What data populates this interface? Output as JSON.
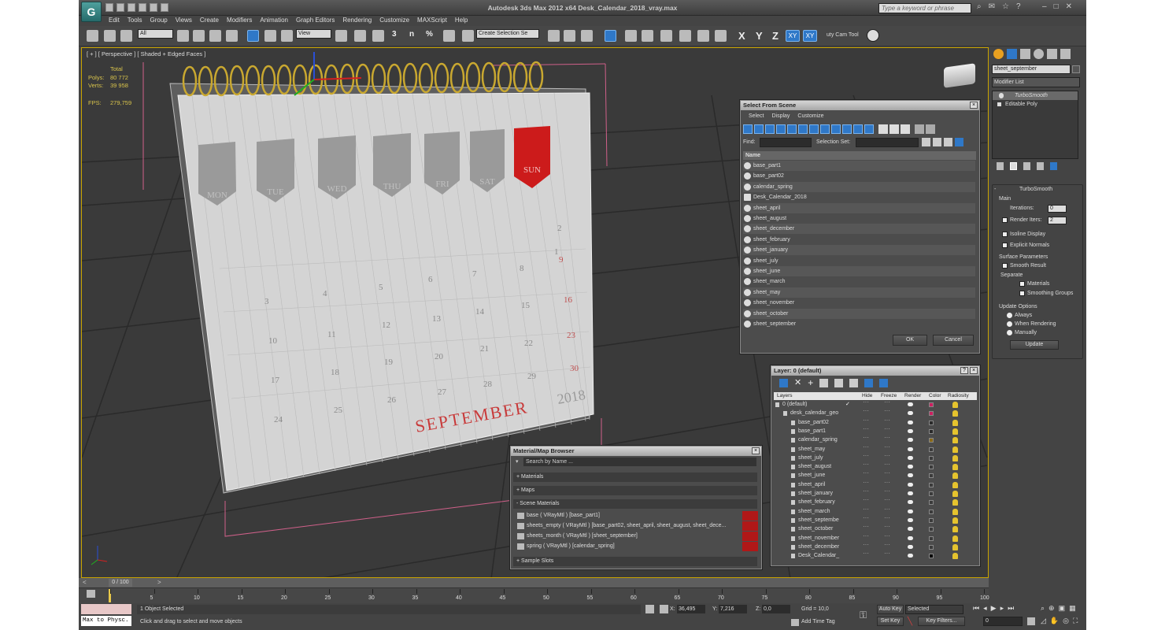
{
  "window": {
    "title": "Autodesk 3ds Max  2012 x64     Desk_Calendar_2018_vray.max",
    "search_placeholder": "Type a keyword or phrase",
    "app_letter": "G"
  },
  "menu": [
    "Edit",
    "Tools",
    "Group",
    "Views",
    "Create",
    "Modifiers",
    "Animation",
    "Graph Editors",
    "Rendering",
    "Customize",
    "MAXScript",
    "Help"
  ],
  "toolbar": {
    "filter": "All",
    "ref_coord": "View",
    "selection_set": "Create Selection Se",
    "snaps_label": "3",
    "angle_label": "n",
    "pct_label": "%",
    "axis_x": "X",
    "axis_y": "Y",
    "axis_z": "Z",
    "axis_xy": "XY",
    "axis_xy2": "XY",
    "tool_label": "uty Cam Tool"
  },
  "viewport": {
    "label": "[ + ] [ Perspective ] [ Shaded + Edged Faces ]",
    "stats_total": "Total",
    "polys_label": "Polys:",
    "polys": "80 772",
    "verts_label": "Verts:",
    "verts": "39 958",
    "fps_label": "FPS:",
    "fps": "279,759"
  },
  "calendar": {
    "month": "SEPTEMBER",
    "year": "2018",
    "weekdays": [
      "MON",
      "TUE",
      "WED",
      "THU",
      "FRI",
      "SAT",
      "SUN"
    ],
    "dates": [
      "3",
      "4",
      "5",
      "6",
      "7",
      "8",
      "9",
      "10",
      "11",
      "12",
      "13",
      "14",
      "15",
      "16",
      "17",
      "18",
      "19",
      "20",
      "21",
      "22",
      "23",
      "24",
      "25",
      "26",
      "27",
      "28",
      "29",
      "30",
      "1",
      "2"
    ]
  },
  "select_from_scene": {
    "title": "Select From Scene",
    "menu": [
      "Select",
      "Display",
      "Customize"
    ],
    "find_label": "Find:",
    "selection_set_label": "Selection Set:",
    "column": "Name",
    "items": [
      "base_part1",
      "base_part02",
      "calendar_spring",
      "Desk_Calendar_2018",
      "sheet_april",
      "sheet_august",
      "sheet_december",
      "sheet_february",
      "sheet_january",
      "sheet_july",
      "sheet_june",
      "sheet_march",
      "sheet_may",
      "sheet_november",
      "sheet_october",
      "sheet_september"
    ],
    "ok": "OK",
    "cancel": "Cancel"
  },
  "layer_dialog": {
    "title": "Layer: 0 (default)",
    "columns": [
      "Layers",
      "Hide",
      "Freeze",
      "Render",
      "Color",
      "Radiosity"
    ],
    "rows": [
      {
        "name": "0 (default)",
        "color": "#cc2060",
        "check": "✓",
        "indent": 0
      },
      {
        "name": "desk_calendar_geo",
        "color": "#cc2060",
        "check": "",
        "indent": 1
      },
      {
        "name": "base_part02",
        "color": "#2a2a2a",
        "check": "",
        "indent": 2
      },
      {
        "name": "base_part1",
        "color": "#2a2a2a",
        "check": "",
        "indent": 2
      },
      {
        "name": "calendar_spring",
        "color": "#8a6a18",
        "check": "",
        "indent": 2
      },
      {
        "name": "sheet_may",
        "color": "#3a3a3a",
        "check": "",
        "indent": 2
      },
      {
        "name": "sheet_july",
        "color": "#3a3a3a",
        "check": "",
        "indent": 2
      },
      {
        "name": "sheet_august",
        "color": "#3a3a3a",
        "check": "",
        "indent": 2
      },
      {
        "name": "sheet_june",
        "color": "#3a3a3a",
        "check": "",
        "indent": 2
      },
      {
        "name": "sheet_april",
        "color": "#3a3a3a",
        "check": "",
        "indent": 2
      },
      {
        "name": "sheet_january",
        "color": "#3a3a3a",
        "check": "",
        "indent": 2
      },
      {
        "name": "sheet_february",
        "color": "#3a3a3a",
        "check": "",
        "indent": 2
      },
      {
        "name": "sheet_march",
        "color": "#3a3a3a",
        "check": "",
        "indent": 2
      },
      {
        "name": "sheet_septembe",
        "color": "#3a3a3a",
        "check": "",
        "indent": 2
      },
      {
        "name": "sheet_october",
        "color": "#3a3a3a",
        "check": "",
        "indent": 2
      },
      {
        "name": "sheet_november",
        "color": "#3a3a3a",
        "check": "",
        "indent": 2
      },
      {
        "name": "sheet_december",
        "color": "#3a3a3a",
        "check": "",
        "indent": 2
      },
      {
        "name": "Desk_Calendar_",
        "color": "#000000",
        "check": "",
        "indent": 2
      }
    ]
  },
  "material_browser": {
    "title": "Material/Map Browser",
    "search": "Search by Name ...",
    "sections": [
      "+ Materials",
      "+ Maps",
      "- Scene Materials"
    ],
    "materials": [
      "base  ( VRayMtl )  [base_part1]",
      "sheets_empty  ( VRayMtl )  [base_part02, sheet_april, sheet_august, sheet_dece...",
      "sheets_month  ( VRayMtl )  [sheet_september]",
      "spring  ( VRayMtl )  [calendar_spring]"
    ],
    "sample_slots": "+ Sample Slots"
  },
  "command_panel": {
    "object_name": "sheet_september",
    "modifier_list": "Modifier List",
    "stack": [
      "TurboSmooth",
      "Editable Poly"
    ],
    "rollout_title": "TurboSmooth",
    "main": "Main",
    "iterations_label": "Iterations:",
    "iterations": "0",
    "render_iters_label": "Render Iters:",
    "render_iters": "2",
    "isoline": "Isoline Display",
    "explicit": "Explicit Normals",
    "surface_params": "Surface Parameters",
    "smooth_result": "Smooth Result",
    "separate": "Separate",
    "materials": "Materials",
    "smoothing_groups": "Smoothing Groups",
    "update_options": "Update Options",
    "always": "Always",
    "when_rendering": "When Rendering",
    "manually": "Manually",
    "update": "Update"
  },
  "timeline": {
    "frame": "0 / 100",
    "ticks": [
      "0",
      "5",
      "10",
      "15",
      "20",
      "25",
      "30",
      "35",
      "40",
      "45",
      "50",
      "55",
      "60",
      "65",
      "70",
      "75",
      "80",
      "85",
      "90",
      "95",
      "100"
    ]
  },
  "status": {
    "maxscript": "Max to Physc.",
    "selected": "1 Object Selected",
    "prompt": "Click and drag to select and move objects",
    "x_label": "X:",
    "x": "36,495",
    "y_label": "Y:",
    "y": "7,216",
    "z_label": "Z:",
    "z": "0,0",
    "grid": "Grid = 10,0",
    "add_time_tag": "Add Time Tag",
    "auto_key": "Auto Key",
    "set_key": "Set Key",
    "key_mode": "Selected",
    "key_filters": "Key Filters...",
    "frame_field": "0"
  }
}
